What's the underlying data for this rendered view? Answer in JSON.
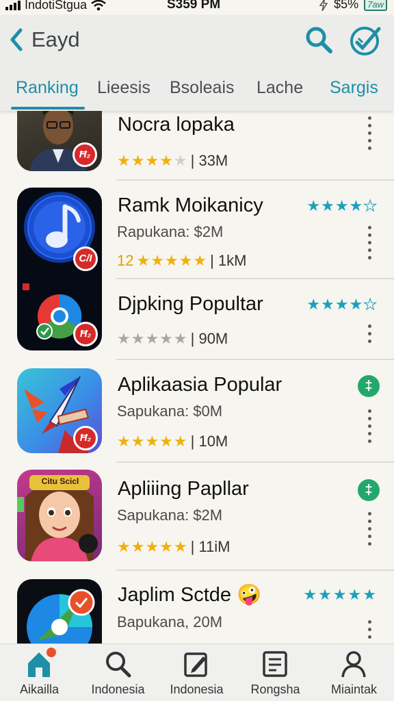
{
  "status_bar": {
    "carrier": "IndotiStgua",
    "time": "S359 PM",
    "battery": "$5%",
    "battery_badge": "7aw"
  },
  "header": {
    "title": "Eayd"
  },
  "tabs": [
    {
      "label": "Ranking",
      "active": true
    },
    {
      "label": "Lieesis",
      "active": false
    },
    {
      "label": "Bsoleais",
      "active": false
    },
    {
      "label": "Lache",
      "active": false
    },
    {
      "label": "Sargis",
      "active": false
    }
  ],
  "apps": [
    {
      "name": "Nocra lopaka",
      "meta": "| 33M",
      "stars": 4,
      "icon_badge": "Ħ₂",
      "icon": "person-photo-icon"
    },
    {
      "name": "Ramk Moikanicy",
      "subtitle": "Rapukana: $2M",
      "rating_prefix": "12",
      "meta": "| 1kM",
      "stars": 5,
      "right_stars": 4.5,
      "icon_badge": "C/I",
      "icon": "music-note-icon"
    },
    {
      "name": "Djpking Popultar",
      "meta": "| 90M",
      "stars": 5,
      "stars_grey": true,
      "right_stars": 4,
      "icon_badge": "Ħ₂",
      "icon": "browser-logo-icon"
    },
    {
      "name": "Aplikaasia Popular",
      "subtitle": "Sapukana: $0M",
      "meta": "| 10M",
      "stars": 5,
      "badge": "‡",
      "icon_badge": "Ħ₂",
      "icon": "rocket-icon"
    },
    {
      "name": "Apliiing Papllar",
      "subtitle": "Sapukana: $2M",
      "meta": "| 11iM",
      "stars": 5,
      "badge": "‡",
      "icon_banner": "Citu Scicl",
      "icon": "cartoon-girl-icon"
    },
    {
      "name": "Japlim Sctde 🤪",
      "subtitle": "Bapukana, 20M",
      "right_stars": 5,
      "icon": "compass-globe-icon"
    }
  ],
  "bottom_nav": [
    {
      "label": "Aikailla",
      "icon": "home-icon",
      "active": true
    },
    {
      "label": "Indonesia",
      "icon": "search-icon"
    },
    {
      "label": "Indonesia",
      "icon": "edit-icon"
    },
    {
      "label": "Rongsha",
      "icon": "document-icon"
    },
    {
      "label": "Miaintak",
      "icon": "person-icon"
    }
  ],
  "colors": {
    "accent": "#1d8fa6",
    "star": "#f0b00c",
    "rating_blue": "#1aa0bd",
    "badge_green": "#23a86b",
    "badge_red": "#d62a2a"
  }
}
